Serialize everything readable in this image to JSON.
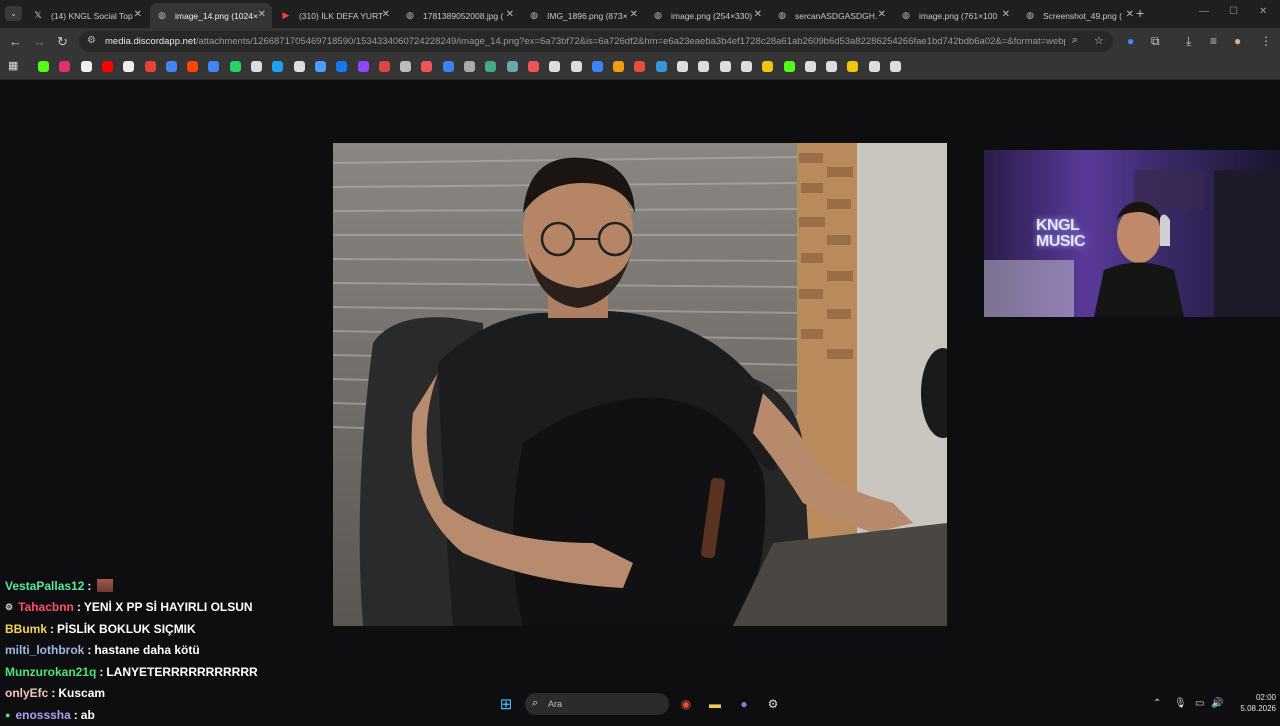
{
  "browser": {
    "tabs": [
      {
        "title": "(14) KNGL Social Top",
        "favicon": "x-icon",
        "active": false
      },
      {
        "title": "image_14.png (1024×",
        "favicon": "globe-icon",
        "active": true
      },
      {
        "title": "(310) İLK DEFA YURT",
        "favicon": "youtube-icon",
        "active": false
      },
      {
        "title": "1781389052008.jpg (",
        "favicon": "globe-icon",
        "active": false
      },
      {
        "title": "IMG_1896.png (873×",
        "favicon": "globe-icon",
        "active": false
      },
      {
        "title": "image.png (254×330)",
        "favicon": "globe-icon",
        "active": false
      },
      {
        "title": "sercanASDGASDGH.",
        "favicon": "globe-icon",
        "active": false
      },
      {
        "title": "image.png (761×100",
        "favicon": "globe-icon",
        "active": false
      },
      {
        "title": "Screenshot_49.png (",
        "favicon": "globe-icon",
        "active": false
      }
    ],
    "address": {
      "host": "media.discordapp.net",
      "path": "/attachments/1266871705469718590/1534334060724228249/image_14.png?ex=6a73bf72&is=6a726df2&hm=e6a23eaeba3b4ef1728c28a61ab2609b6d53a82286254266fae1bd742bdb6a02&=&format=webp&..."
    },
    "bookmark_icons": [
      "kick-icon",
      "instagram-icon",
      "x-icon",
      "youtube-icon",
      "google-icon",
      "gmail-icon",
      "drive-icon",
      "reddit-icon",
      "translate-icon",
      "whatsapp-icon",
      "app-icon",
      "shazam-icon",
      "calendar-icon",
      "arrow-icon",
      "facebook-icon",
      "twitch-icon",
      "dart-icon",
      "feather-icon",
      "game-icon",
      "bing-icon",
      "play-icon",
      "photo-icon",
      "tool-icon",
      "pin-icon",
      "globe-icon",
      "web-icon",
      "store-icon",
      "cup-icon",
      "chart-icon",
      "nav-icon",
      "app-icon",
      "box-icon",
      "stack-icon",
      "star-icon",
      "pacman-icon",
      "kick-icon",
      "app-icon",
      "tsd-icon",
      "folder-icon",
      "openai-icon",
      "grid-icon"
    ]
  },
  "stream": {
    "webcam_logo_line1": "KNGL",
    "webcam_logo_line2": "MUSIC"
  },
  "chat": {
    "messages": [
      {
        "user": "VestaPallas12",
        "color": "#58e6a2",
        "text": "",
        "emote": true,
        "badge": ""
      },
      {
        "user": "Tahacbnn",
        "color": "#ff4f6b",
        "text": "YENİ X PP Sİ HAYIRLI OLSUN",
        "emote": false,
        "badge": "⚙"
      },
      {
        "user": "BBumk",
        "color": "#f4d35e",
        "text": "PİSLİK BOKLUK SIÇMIK",
        "emote": false,
        "badge": ""
      },
      {
        "user": "milti_lothbrok",
        "color": "#9fb6e8",
        "text": "hastane daha kötü",
        "emote": false,
        "badge": ""
      },
      {
        "user": "Munzurokan21q",
        "color": "#4ee37a",
        "text": "LANYETERRRRRRRRRRR",
        "emote": false,
        "badge": ""
      },
      {
        "user": "onlyEfc",
        "color": "#f0c6b6",
        "text": "Kuscam",
        "emote": false,
        "badge": ""
      },
      {
        "user": "enossshа",
        "color": "#b39df2",
        "text": "ab",
        "emote": false,
        "badge": "●"
      }
    ]
  },
  "taskbar": {
    "search_placeholder": "Ara",
    "time": "02:00",
    "date": "5.08.2026"
  }
}
